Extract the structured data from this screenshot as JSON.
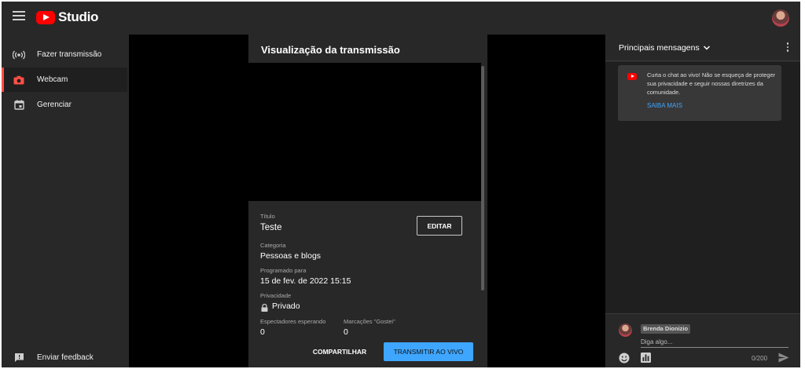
{
  "app": {
    "name": "Studio"
  },
  "sidebar": {
    "items": [
      {
        "label": "Fazer transmissão",
        "icon": "broadcast-icon"
      },
      {
        "label": "Webcam",
        "icon": "camera-icon",
        "active": true
      },
      {
        "label": "Gerenciar",
        "icon": "calendar-icon"
      }
    ],
    "feedback_label": "Enviar feedback"
  },
  "preview_panel": {
    "title": "Visualização da transmissão",
    "title_label": "Título",
    "title_value": "Teste",
    "edit_label": "EDITAR",
    "category_label": "Categoria",
    "category_value": "Pessoas e blogs",
    "scheduled_label": "Programado para",
    "scheduled_value": "15 de fev. de 2022 15:15",
    "privacy_label": "Privacidade",
    "privacy_value": "Privado",
    "waiting_label": "Espectadores esperando",
    "waiting_value": "0",
    "likes_label": "Marcações \"Gostei\"",
    "likes_value": "0",
    "share_label": "COMPARTILHAR",
    "go_live_label": "TRANSMITIR AO VIVO"
  },
  "chat": {
    "title": "Principais mensagens",
    "welcome_text": "Curta o chat ao vivo! Não se esqueça de proteger sua privacidade e seguir nossas diretrizes da comunidade.",
    "learn_more_label": "SAIBA MAIS",
    "author_name": "Brenda Dionizio",
    "input_placeholder": "Diga algo...",
    "char_counter": "0/200"
  },
  "colors": {
    "accent": "#3ea6ff",
    "brand_red": "#ff0000",
    "active_indicator": "#ff4e45",
    "background": "#282828"
  }
}
